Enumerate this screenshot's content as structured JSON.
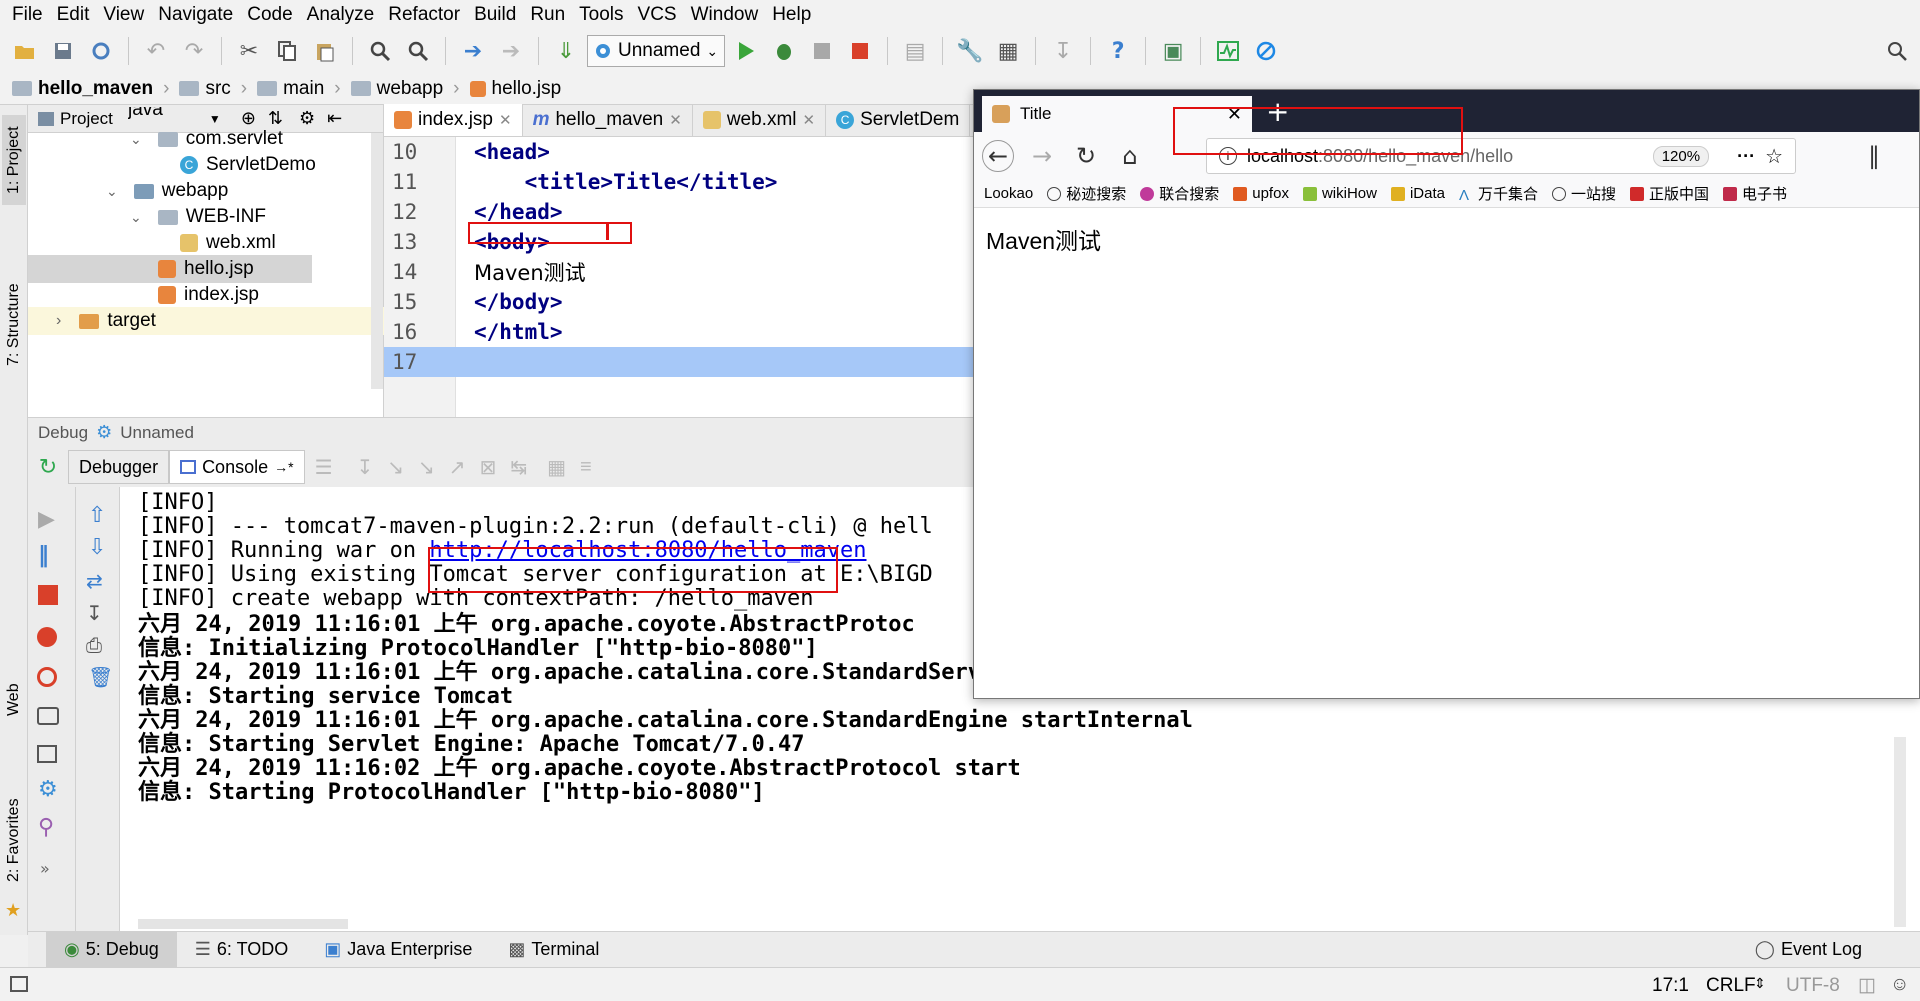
{
  "menu": [
    "File",
    "Edit",
    "View",
    "Navigate",
    "Code",
    "Analyze",
    "Refactor",
    "Build",
    "Run",
    "Tools",
    "VCS",
    "Window",
    "Help"
  ],
  "toolbar": {
    "run_config": "Unnamed"
  },
  "breadcrumb": [
    "hello_maven",
    "src",
    "main",
    "webapp",
    "hello.jsp"
  ],
  "left_strip": {
    "project": "1: Project",
    "structure": "7: Structure",
    "web": "Web",
    "favorites": "2: Favorites"
  },
  "project": {
    "header": "Project",
    "tree": [
      {
        "label": "java",
        "indent": 0
      },
      {
        "label": "com.servlet",
        "indent": 1
      },
      {
        "label": "ServletDemo",
        "indent": 2
      },
      {
        "label": "webapp",
        "indent": 0
      },
      {
        "label": "WEB-INF",
        "indent": 1
      },
      {
        "label": "web.xml",
        "indent": 2
      },
      {
        "label": "hello.jsp",
        "indent": 1
      },
      {
        "label": "index.jsp",
        "indent": 1
      },
      {
        "label": "target",
        "indent": -1
      }
    ]
  },
  "editor": {
    "tabs": [
      "index.jsp",
      "hello_maven",
      "web.xml",
      "ServletDem"
    ],
    "lines": [
      {
        "num": "10",
        "text": "<head>"
      },
      {
        "num": "11",
        "text": "    <title>Title</title>"
      },
      {
        "num": "12",
        "text": "</head>"
      },
      {
        "num": "13",
        "text": "<body>"
      },
      {
        "num": "14",
        "text": "Maven测试"
      },
      {
        "num": "15",
        "text": "</body>"
      },
      {
        "num": "16",
        "text": "</html>"
      },
      {
        "num": "17",
        "text": ""
      }
    ]
  },
  "debug": {
    "label": "Debug",
    "config": "Unnamed",
    "tabs": [
      "Debugger",
      "Console"
    ]
  },
  "console": {
    "lines": [
      {
        "text": "[INFO]",
        "bold": false
      },
      {
        "text": "[INFO] --- tomcat7-maven-plugin:2.2:run (default-cli) @ hell",
        "bold": false
      },
      {
        "text": "[INFO] Running war on ",
        "bold": false,
        "link": "http://localhost:8080/hello_maven"
      },
      {
        "text": "[INFO] Using existing Tomcat server configuration at E:\\BIGD",
        "bold": false
      },
      {
        "text": "[INFO] create webapp with contextPath: /hello_maven",
        "bold": false
      },
      {
        "text": "六月 24, 2019 11:16:01 上午 org.apache.coyote.AbstractProtoc",
        "bold": true
      },
      {
        "text": "信息: Initializing ProtocolHandler [\"http-bio-8080\"]",
        "bold": true
      },
      {
        "text": "六月 24, 2019 11:16:01 上午 org.apache.catalina.core.StandardService startInternal",
        "bold": true
      },
      {
        "text": "信息: Starting service Tomcat",
        "bold": true
      },
      {
        "text": "六月 24, 2019 11:16:01 上午 org.apache.catalina.core.StandardEngine startInternal",
        "bold": true
      },
      {
        "text": "信息: Starting Servlet Engine: Apache Tomcat/7.0.47",
        "bold": true
      },
      {
        "text": "六月 24, 2019 11:16:02 上午 org.apache.coyote.AbstractProtocol start",
        "bold": true
      },
      {
        "text": "信息: Starting ProtocolHandler [\"http-bio-8080\"]",
        "bold": true
      }
    ]
  },
  "bottom_tools": [
    "5: Debug",
    "6: TODO",
    "Java Enterprise",
    "Terminal",
    "Event Log"
  ],
  "status": {
    "position": "17:1",
    "line_sep": "CRLF",
    "encoding": "UTF-8"
  },
  "browser": {
    "tab_title": "Title",
    "url_host": "localhost",
    "url_path": ":8080/hello_maven/hello",
    "zoom": "120%",
    "bookmarks": [
      "Lookao",
      "秘迹搜索",
      "联合搜索",
      "upfox",
      "wikiHow",
      "iData",
      "万千集合",
      "一站搜",
      "正版中国",
      "电子书"
    ],
    "content": "Maven测试"
  },
  "colors": {
    "accent": "#e01010",
    "link": "#0000ee",
    "tag": "#000080",
    "selection": "#a6c8f8"
  }
}
